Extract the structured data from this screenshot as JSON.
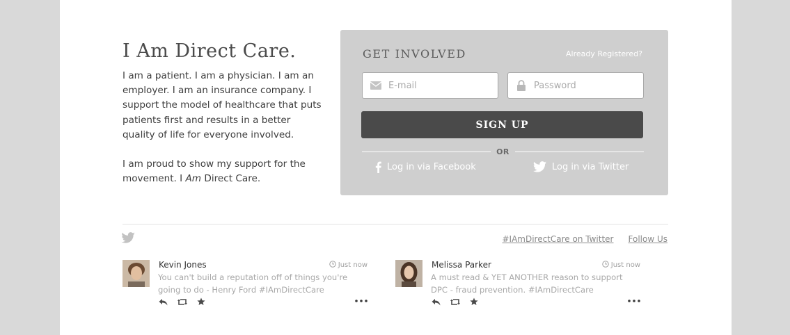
{
  "intro": {
    "title": "I Am Direct Care.",
    "paragraph1": "I am a patient. I am a physician. I am an employer. I am an insurance company. I support the model of healthcare that puts patients first and results in a better quality of life for everyone involved.",
    "paragraph2_before": "I am proud to show my support for the movement. I ",
    "paragraph2_em": "Am",
    "paragraph2_after": " Direct Care."
  },
  "signup": {
    "title": "GET INVOLVED",
    "already_registered": "Already Registered?",
    "email_placeholder": "E-mail",
    "password_placeholder": "Password",
    "signup_label": "SIGN UP",
    "or_label": "OR",
    "facebook_label": "Log in via Facebook",
    "twitter_label": "Log in via Twitter"
  },
  "feed": {
    "hashtag_link": "#IAmDirectCare on Twitter",
    "follow_link": "Follow Us",
    "tweets": [
      {
        "name": "Kevin Jones",
        "time": "Just now",
        "text": "You can't build a reputation off of things you're going to do - Henry Ford #IAmDirectCare"
      },
      {
        "name": "Melissa Parker",
        "time": "Just now",
        "text": "A must read & YET ANOTHER reason to support DPC - fraud prevention. #IAmDirectCare"
      }
    ]
  },
  "colors": {
    "background": "#d9d9d9",
    "panel": "#cfcfcf",
    "button": "#4a4a4a"
  },
  "icons": [
    "envelope-icon",
    "lock-icon",
    "facebook-icon",
    "twitter-icon",
    "clock-icon",
    "reply-icon",
    "retweet-icon",
    "favorite-icon",
    "more-icon"
  ]
}
